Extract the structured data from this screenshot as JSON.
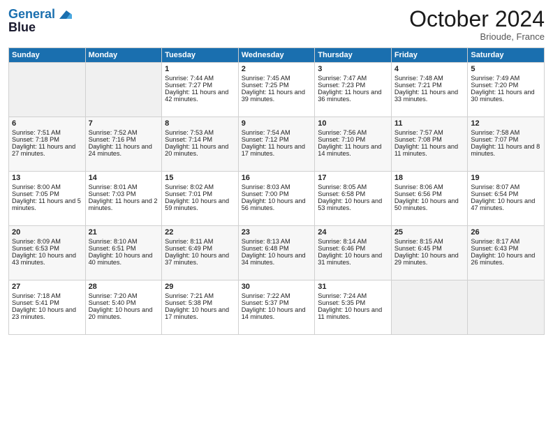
{
  "header": {
    "logo_line1": "General",
    "logo_line2": "Blue",
    "month": "October 2024",
    "location": "Brioude, France"
  },
  "columns": [
    "Sunday",
    "Monday",
    "Tuesday",
    "Wednesday",
    "Thursday",
    "Friday",
    "Saturday"
  ],
  "weeks": [
    [
      {
        "day": "",
        "info": ""
      },
      {
        "day": "",
        "info": ""
      },
      {
        "day": "1",
        "info": "Sunrise: 7:44 AM\nSunset: 7:27 PM\nDaylight: 11 hours and 42 minutes."
      },
      {
        "day": "2",
        "info": "Sunrise: 7:45 AM\nSunset: 7:25 PM\nDaylight: 11 hours and 39 minutes."
      },
      {
        "day": "3",
        "info": "Sunrise: 7:47 AM\nSunset: 7:23 PM\nDaylight: 11 hours and 36 minutes."
      },
      {
        "day": "4",
        "info": "Sunrise: 7:48 AM\nSunset: 7:21 PM\nDaylight: 11 hours and 33 minutes."
      },
      {
        "day": "5",
        "info": "Sunrise: 7:49 AM\nSunset: 7:20 PM\nDaylight: 11 hours and 30 minutes."
      }
    ],
    [
      {
        "day": "6",
        "info": "Sunrise: 7:51 AM\nSunset: 7:18 PM\nDaylight: 11 hours and 27 minutes."
      },
      {
        "day": "7",
        "info": "Sunrise: 7:52 AM\nSunset: 7:16 PM\nDaylight: 11 hours and 24 minutes."
      },
      {
        "day": "8",
        "info": "Sunrise: 7:53 AM\nSunset: 7:14 PM\nDaylight: 11 hours and 20 minutes."
      },
      {
        "day": "9",
        "info": "Sunrise: 7:54 AM\nSunset: 7:12 PM\nDaylight: 11 hours and 17 minutes."
      },
      {
        "day": "10",
        "info": "Sunrise: 7:56 AM\nSunset: 7:10 PM\nDaylight: 11 hours and 14 minutes."
      },
      {
        "day": "11",
        "info": "Sunrise: 7:57 AM\nSunset: 7:08 PM\nDaylight: 11 hours and 11 minutes."
      },
      {
        "day": "12",
        "info": "Sunrise: 7:58 AM\nSunset: 7:07 PM\nDaylight: 11 hours and 8 minutes."
      }
    ],
    [
      {
        "day": "13",
        "info": "Sunrise: 8:00 AM\nSunset: 7:05 PM\nDaylight: 11 hours and 5 minutes."
      },
      {
        "day": "14",
        "info": "Sunrise: 8:01 AM\nSunset: 7:03 PM\nDaylight: 11 hours and 2 minutes."
      },
      {
        "day": "15",
        "info": "Sunrise: 8:02 AM\nSunset: 7:01 PM\nDaylight: 10 hours and 59 minutes."
      },
      {
        "day": "16",
        "info": "Sunrise: 8:03 AM\nSunset: 7:00 PM\nDaylight: 10 hours and 56 minutes."
      },
      {
        "day": "17",
        "info": "Sunrise: 8:05 AM\nSunset: 6:58 PM\nDaylight: 10 hours and 53 minutes."
      },
      {
        "day": "18",
        "info": "Sunrise: 8:06 AM\nSunset: 6:56 PM\nDaylight: 10 hours and 50 minutes."
      },
      {
        "day": "19",
        "info": "Sunrise: 8:07 AM\nSunset: 6:54 PM\nDaylight: 10 hours and 47 minutes."
      }
    ],
    [
      {
        "day": "20",
        "info": "Sunrise: 8:09 AM\nSunset: 6:53 PM\nDaylight: 10 hours and 43 minutes."
      },
      {
        "day": "21",
        "info": "Sunrise: 8:10 AM\nSunset: 6:51 PM\nDaylight: 10 hours and 40 minutes."
      },
      {
        "day": "22",
        "info": "Sunrise: 8:11 AM\nSunset: 6:49 PM\nDaylight: 10 hours and 37 minutes."
      },
      {
        "day": "23",
        "info": "Sunrise: 8:13 AM\nSunset: 6:48 PM\nDaylight: 10 hours and 34 minutes."
      },
      {
        "day": "24",
        "info": "Sunrise: 8:14 AM\nSunset: 6:46 PM\nDaylight: 10 hours and 31 minutes."
      },
      {
        "day": "25",
        "info": "Sunrise: 8:15 AM\nSunset: 6:45 PM\nDaylight: 10 hours and 29 minutes."
      },
      {
        "day": "26",
        "info": "Sunrise: 8:17 AM\nSunset: 6:43 PM\nDaylight: 10 hours and 26 minutes."
      }
    ],
    [
      {
        "day": "27",
        "info": "Sunrise: 7:18 AM\nSunset: 5:41 PM\nDaylight: 10 hours and 23 minutes."
      },
      {
        "day": "28",
        "info": "Sunrise: 7:20 AM\nSunset: 5:40 PM\nDaylight: 10 hours and 20 minutes."
      },
      {
        "day": "29",
        "info": "Sunrise: 7:21 AM\nSunset: 5:38 PM\nDaylight: 10 hours and 17 minutes."
      },
      {
        "day": "30",
        "info": "Sunrise: 7:22 AM\nSunset: 5:37 PM\nDaylight: 10 hours and 14 minutes."
      },
      {
        "day": "31",
        "info": "Sunrise: 7:24 AM\nSunset: 5:35 PM\nDaylight: 10 hours and 11 minutes."
      },
      {
        "day": "",
        "info": ""
      },
      {
        "day": "",
        "info": ""
      }
    ]
  ]
}
